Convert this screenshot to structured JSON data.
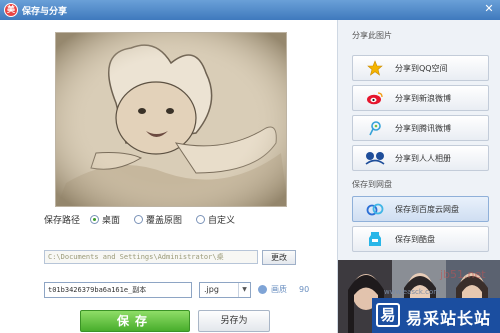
{
  "window": {
    "title": "保存与分享",
    "logo_glyph": "美",
    "close_glyph": "✕"
  },
  "save": {
    "path_label": "保存路径",
    "options": [
      {
        "label": "桌面",
        "selected": true
      },
      {
        "label": "覆盖原图",
        "selected": false
      },
      {
        "label": "自定义",
        "selected": false
      }
    ],
    "path_value": "C:\\Documents and Settings\\Administrator\\桌",
    "change_label": "更改",
    "filename": "t01b3426379ba6a161e_副本",
    "extension": ".jpg",
    "quality_label": "画质",
    "quality_value": "90",
    "save_label": "保存",
    "save_as_label": "另存为"
  },
  "share": {
    "section_label": "分享此图片",
    "buttons": [
      {
        "label": "分享到QQ空间",
        "icon": "qzone-star-icon"
      },
      {
        "label": "分享到新浪微博",
        "icon": "weibo-icon"
      },
      {
        "label": "分享到腾讯微博",
        "icon": "tencent-weibo-icon"
      },
      {
        "label": "分享到人人相册",
        "icon": "renren-icon"
      }
    ]
  },
  "cloud": {
    "section_label": "保存到网盘",
    "buttons": [
      {
        "label": "保存到百度云网盘",
        "icon": "baidu-cloud-icon",
        "active": true
      },
      {
        "label": "保存到酷盘",
        "icon": "kupan-icon",
        "active": false
      }
    ]
  },
  "watermark": {
    "text": "易采站长站",
    "url": "www.easck.com",
    "icon_glyph": "易",
    "overlay": "jb51.net"
  },
  "colors": {
    "titlebar": "#4f88c8",
    "save_green": "#5ab93a",
    "accent_blue": "#1b4ea0"
  }
}
